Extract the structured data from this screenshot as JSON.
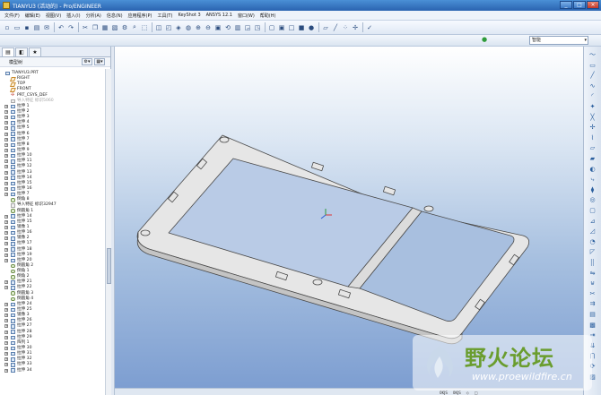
{
  "window": {
    "title": "TIANYU3 (活动的) - Pro/ENGINEER",
    "min": "_",
    "max": "□",
    "close": "×"
  },
  "menu": [
    "文件(F)",
    "编辑(E)",
    "视图(V)",
    "插入(I)",
    "分析(A)",
    "信息(N)",
    "应用程序(P)",
    "工具(T)",
    "KeyShot 3",
    "ANSYS 12.1",
    "窗口(W)",
    "帮助(H)"
  ],
  "toolbar": {
    "icons": [
      "new-icon",
      "open-icon",
      "save-icon",
      "print-icon",
      "email-icon",
      "sep",
      "undo-icon",
      "redo-icon",
      "sep",
      "cut-icon",
      "copy-icon",
      "paste-icon",
      "paste-special-icon",
      "regenerate-icon",
      "find-icon",
      "select-icon",
      "sep",
      "repaint-icon",
      "refit-icon",
      "orient-icon",
      "spin-icon",
      "zoom-in-icon",
      "zoom-out-icon",
      "fit-icon",
      "reorient-icon",
      "saved-views-icon",
      "layers-icon",
      "view-manager-icon",
      "sep",
      "wireframe-icon",
      "hidden-line-icon",
      "no-hidden-icon",
      "shading-icon",
      "appearance-icon",
      "sep",
      "datum-planes-icon",
      "datum-axes-icon",
      "datum-points-icon",
      "csys-icon",
      "sep",
      "info-icon"
    ],
    "glyphs": {
      "new-icon": "▫",
      "open-icon": "▭",
      "save-icon": "▪",
      "print-icon": "▤",
      "email-icon": "✉",
      "undo-icon": "↶",
      "redo-icon": "↷",
      "cut-icon": "✂",
      "copy-icon": "❐",
      "paste-icon": "▦",
      "paste-special-icon": "▧",
      "regenerate-icon": "⚙",
      "find-icon": "⌕",
      "select-icon": "⬚",
      "repaint-icon": "◫",
      "refit-icon": "◰",
      "orient-icon": "◈",
      "spin-icon": "◍",
      "zoom-in-icon": "⊕",
      "zoom-out-icon": "⊖",
      "fit-icon": "▣",
      "reorient-icon": "⟲",
      "saved-views-icon": "▥",
      "layers-icon": "◲",
      "view-manager-icon": "◳",
      "wireframe-icon": "▢",
      "hidden-line-icon": "▣",
      "no-hidden-icon": "□",
      "shading-icon": "■",
      "appearance-icon": "●",
      "datum-planes-icon": "▱",
      "datum-axes-icon": "╱",
      "datum-points-icon": "⁘",
      "csys-icon": "✢",
      "info-icon": "✓"
    }
  },
  "filter": {
    "value": "智能",
    "arrow": "▾"
  },
  "model_tree": {
    "header": "模型树",
    "tabs": [
      "tab-model-tree",
      "tab-folder",
      "tab-favorites"
    ],
    "tab_glyphs": [
      "▤",
      "◧",
      "★"
    ],
    "settings_btn": "⚙▾",
    "show_btn": "▦▾",
    "items": [
      {
        "label": "TIANYU3.PRT",
        "icon": "part",
        "expand": false,
        "indent": 0
      },
      {
        "label": "RIGHT",
        "icon": "plane",
        "expand": false,
        "indent": 1
      },
      {
        "label": "TOP",
        "icon": "plane",
        "expand": false,
        "indent": 1
      },
      {
        "label": "FRONT",
        "icon": "plane",
        "expand": false,
        "indent": 1
      },
      {
        "label": "PRT_CSYS_DEF",
        "icon": "csys",
        "expand": false,
        "indent": 1
      },
      {
        "label": "导入特征 标识5060",
        "icon": "grey",
        "expand": false,
        "indent": 1,
        "greyed": true
      },
      {
        "label": "拉伸 1",
        "icon": "feat",
        "expand": true,
        "indent": 1
      },
      {
        "label": "拉伸 2",
        "icon": "feat",
        "expand": true,
        "indent": 1
      },
      {
        "label": "拉伸 3",
        "icon": "feat",
        "expand": true,
        "indent": 1
      },
      {
        "label": "拉伸 4",
        "icon": "feat",
        "expand": true,
        "indent": 1
      },
      {
        "label": "拉伸 5",
        "icon": "feat",
        "expand": true,
        "indent": 1
      },
      {
        "label": "拉伸 6",
        "icon": "feat",
        "expand": true,
        "indent": 1
      },
      {
        "label": "拉伸 7",
        "icon": "feat",
        "expand": true,
        "indent": 1
      },
      {
        "label": "拉伸 8",
        "icon": "feat",
        "expand": true,
        "indent": 1
      },
      {
        "label": "拉伸 9",
        "icon": "feat",
        "expand": true,
        "indent": 1
      },
      {
        "label": "拉伸 10",
        "icon": "feat",
        "expand": true,
        "indent": 1
      },
      {
        "label": "拉伸 11",
        "icon": "feat",
        "expand": true,
        "indent": 1
      },
      {
        "label": "拉伸 12",
        "icon": "feat",
        "expand": true,
        "indent": 1
      },
      {
        "label": "拉伸 13",
        "icon": "feat",
        "expand": true,
        "indent": 1
      },
      {
        "label": "拉伸 14",
        "icon": "feat",
        "expand": true,
        "indent": 1
      },
      {
        "label": "拉伸 15",
        "icon": "feat",
        "expand": true,
        "indent": 1
      },
      {
        "label": "拉伸 16",
        "icon": "feat",
        "expand": true,
        "indent": 1
      },
      {
        "label": "拉伸 7",
        "icon": "feat",
        "expand": true,
        "indent": 1
      },
      {
        "label": "倒角 8",
        "icon": "round",
        "expand": false,
        "indent": 1
      },
      {
        "label": "导入特征 标识32947",
        "icon": "grey",
        "expand": false,
        "indent": 1
      },
      {
        "label": "倒圆角 1",
        "icon": "round",
        "expand": false,
        "indent": 1
      },
      {
        "label": "拉伸 14",
        "icon": "feat",
        "expand": true,
        "indent": 1
      },
      {
        "label": "拉伸 15",
        "icon": "feat",
        "expand": true,
        "indent": 1
      },
      {
        "label": "镜像 1",
        "icon": "feat",
        "expand": true,
        "indent": 1
      },
      {
        "label": "拉伸 16",
        "icon": "feat",
        "expand": true,
        "indent": 1
      },
      {
        "label": "镜像 2",
        "icon": "feat",
        "expand": true,
        "indent": 1
      },
      {
        "label": "拉伸 17",
        "icon": "feat",
        "expand": true,
        "indent": 1
      },
      {
        "label": "拉伸 18",
        "icon": "feat",
        "expand": true,
        "indent": 1
      },
      {
        "label": "拉伸 19",
        "icon": "feat",
        "expand": true,
        "indent": 1
      },
      {
        "label": "拉伸 20",
        "icon": "feat",
        "expand": true,
        "indent": 1
      },
      {
        "label": "倒圆角 2",
        "icon": "round",
        "expand": false,
        "indent": 1
      },
      {
        "label": "倒角 1",
        "icon": "round",
        "expand": false,
        "indent": 1
      },
      {
        "label": "倒角 2",
        "icon": "round",
        "expand": false,
        "indent": 1
      },
      {
        "label": "拉伸 21",
        "icon": "feat",
        "expand": true,
        "indent": 1
      },
      {
        "label": "拉伸 22",
        "icon": "feat",
        "expand": true,
        "indent": 1
      },
      {
        "label": "倒圆角 3",
        "icon": "round",
        "expand": false,
        "indent": 1
      },
      {
        "label": "倒圆角 4",
        "icon": "round",
        "expand": false,
        "indent": 1
      },
      {
        "label": "拉伸 24",
        "icon": "feat",
        "expand": true,
        "indent": 1
      },
      {
        "label": "拉伸 25",
        "icon": "feat",
        "expand": true,
        "indent": 1
      },
      {
        "label": "镜像 3",
        "icon": "feat",
        "expand": true,
        "indent": 1
      },
      {
        "label": "拉伸 26",
        "icon": "feat",
        "expand": true,
        "indent": 1
      },
      {
        "label": "拉伸 27",
        "icon": "feat",
        "expand": true,
        "indent": 1
      },
      {
        "label": "拉伸 28",
        "icon": "feat",
        "expand": true,
        "indent": 1
      },
      {
        "label": "拉伸 29",
        "icon": "feat",
        "expand": true,
        "indent": 1
      },
      {
        "label": "阵列 1",
        "icon": "feat",
        "expand": true,
        "indent": 1
      },
      {
        "label": "拉伸 30",
        "icon": "feat",
        "expand": true,
        "indent": 1
      },
      {
        "label": "拉伸 31",
        "icon": "feat",
        "expand": true,
        "indent": 1
      },
      {
        "label": "拉伸 32",
        "icon": "feat",
        "expand": true,
        "indent": 1
      },
      {
        "label": "拉伸 33",
        "icon": "feat",
        "expand": true,
        "indent": 1
      },
      {
        "label": "拉伸 34",
        "icon": "feat",
        "expand": true,
        "indent": 1
      }
    ]
  },
  "right_toolbar": {
    "icons": [
      "sketch-icon",
      "rect-icon",
      "line-icon",
      "spline-icon",
      "arc-icon",
      "point-icon",
      "axis-icon",
      "csys-icon",
      "curve-icon",
      "datum-plane-icon",
      "extrude-icon",
      "revolve-icon",
      "sweep-icon",
      "blend-icon",
      "hole-icon",
      "shell-icon",
      "rib-icon",
      "draft-icon",
      "round-icon",
      "chamfer-icon",
      "pattern-icon",
      "mirror-icon",
      "merge-icon",
      "trim-icon",
      "offset-icon",
      "thicken-icon",
      "solidify-icon",
      "extend-icon",
      "project-icon",
      "intersect-icon",
      "wrap-icon",
      "fill-icon"
    ],
    "glyphs": [
      "〜",
      "▭",
      "╱",
      "∿",
      "◜",
      "✦",
      "╳",
      "✢",
      "⌇",
      "▱",
      "▰",
      "◐",
      "⤷",
      "⧫",
      "◎",
      "▢",
      "⊿",
      "◿",
      "◔",
      "◸",
      "⣿",
      "⇋",
      "⊎",
      "✂",
      "⇉",
      "▤",
      "▩",
      "⇥",
      "⇊",
      "⋂",
      "⟳",
      "▨"
    ]
  },
  "statusbar": {
    "items": [
      "0KJS",
      "0KJS",
      "◇",
      "□"
    ]
  },
  "watermark": {
    "title": "野火论坛",
    "url": "www.proewildfire.cn"
  },
  "colors": {
    "model": "#e6e6e6",
    "model_edge": "#4a4a4a",
    "viewport_top": "#ffffff",
    "viewport_bottom": "#7d9ed1",
    "watermark_green": "#6a9d2e"
  }
}
